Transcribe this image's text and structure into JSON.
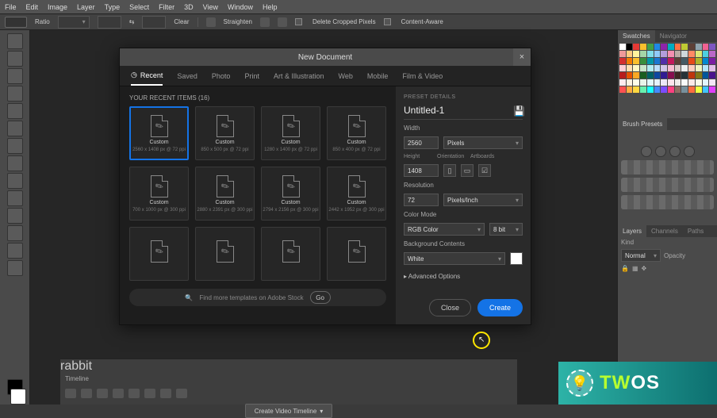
{
  "menubar": [
    "File",
    "Edit",
    "Image",
    "Layer",
    "Type",
    "Select",
    "Filter",
    "3D",
    "View",
    "Window",
    "Help"
  ],
  "optbar": {
    "ratio_label": "Ratio",
    "clear_label": "Clear",
    "straighten_label": "Straighten",
    "delete_cropped_label": "Delete Cropped Pixels",
    "content_aware_label": "Content-Aware"
  },
  "right": {
    "swatches_tab": "Swatches",
    "navigator_tab": "Navigator",
    "brush_tab": "Brush Presets",
    "layers_tab": "Layers",
    "channels_tab": "Channels",
    "paths_tab": "Paths",
    "kind_label": "Kind",
    "normal_label": "Normal",
    "opacity_label": "Opacity"
  },
  "dialog": {
    "title": "New Document",
    "tabs": {
      "recent": "Recent",
      "saved": "Saved",
      "photo": "Photo",
      "print": "Print",
      "art": "Art & Illustration",
      "web": "Web",
      "mobile": "Mobile",
      "film": "Film & Video"
    },
    "recent_header": "YOUR RECENT ITEMS (16)",
    "presets": [
      {
        "label": "Custom",
        "dim": "2560 x 1408 px @ 72 ppi"
      },
      {
        "label": "Custom",
        "dim": "850 x 500 px @ 72 ppi"
      },
      {
        "label": "Custom",
        "dim": "1280 x 1400 px @ 72 ppi"
      },
      {
        "label": "Custom",
        "dim": "850 x 400 px @ 72 ppi"
      },
      {
        "label": "Custom",
        "dim": "700 x 1000 px @ 300 ppi"
      },
      {
        "label": "Custom",
        "dim": "2880 x 2391 px @ 300 ppi"
      },
      {
        "label": "Custom",
        "dim": "2794 x 2156 px @ 300 ppi"
      },
      {
        "label": "Custom",
        "dim": "2442 x 1952 px @ 300 ppi"
      },
      {
        "label": "",
        "dim": ""
      },
      {
        "label": "",
        "dim": ""
      },
      {
        "label": "",
        "dim": ""
      },
      {
        "label": "",
        "dim": ""
      }
    ],
    "stock_text": "Find more templates on Adobe Stock",
    "go_label": "Go",
    "details": {
      "header": "PRESET DETAILS",
      "name": "Untitled-1",
      "width_label": "Width",
      "width_value": "2560",
      "width_unit": "Pixels",
      "height_label": "Height",
      "height_value": "1408",
      "orientation_label": "Orientation",
      "artboards_label": "Artboards",
      "resolution_label": "Resolution",
      "resolution_value": "72",
      "resolution_unit": "Pixels/Inch",
      "colormode_label": "Color Mode",
      "colormode_value": "RGB Color",
      "colordepth": "8 bit",
      "bg_label": "Background Contents",
      "bg_value": "White",
      "advanced": "Advanced Options",
      "close": "Close",
      "create": "Create"
    }
  },
  "timeline": {
    "tab": "Timeline",
    "create_btn": "Create Video Timeline"
  },
  "watermark": {
    "a": "TW",
    "b": "OS"
  },
  "swatch_colors": [
    "#ffffff",
    "#000000",
    "#e53935",
    "#fbc02d",
    "#43a047",
    "#1e88e5",
    "#8e24aa",
    "#00acc1",
    "#ff7043",
    "#c0ca33",
    "#5d4037",
    "#90a4ae",
    "#f06292",
    "#7e57c2",
    "#ef9a9a",
    "#ffcc80",
    "#fff59d",
    "#a5d6a7",
    "#80deea",
    "#90caf9",
    "#b39ddb",
    "#f48fb1",
    "#bcaaa4",
    "#cfd8dc",
    "#ff8a65",
    "#dce775",
    "#4dd0e1",
    "#ba68c8",
    "#d32f2f",
    "#f57c00",
    "#fbc02d",
    "#388e3c",
    "#0097a7",
    "#1976d2",
    "#512da8",
    "#c2185b",
    "#5d4037",
    "#455a64",
    "#e64a19",
    "#afb42b",
    "#0288d1",
    "#7b1fa2",
    "#ffcdd2",
    "#ffe0b2",
    "#fff9c4",
    "#c8e6c9",
    "#b2ebf2",
    "#bbdefb",
    "#d1c4e9",
    "#f8bbd0",
    "#d7ccc8",
    "#eceff1",
    "#ffccbc",
    "#f0f4c3",
    "#b3e5fc",
    "#e1bee7",
    "#b71c1c",
    "#e65100",
    "#f9a825",
    "#1b5e20",
    "#006064",
    "#0d47a1",
    "#311b92",
    "#880e4f",
    "#3e2723",
    "#263238",
    "#bf360c",
    "#827717",
    "#01579b",
    "#4a148c",
    "#ffebee",
    "#fff3e0",
    "#fffde7",
    "#e8f5e9",
    "#e0f7fa",
    "#e3f2fd",
    "#ede7f6",
    "#fce4ec",
    "#efebe9",
    "#fafafa",
    "#fbe9e7",
    "#f9fbe7",
    "#e1f5fe",
    "#f3e5f5",
    "#ff5252",
    "#ffab40",
    "#ffd740",
    "#69f0ae",
    "#18ffff",
    "#448aff",
    "#7c4dff",
    "#ff4081",
    "#8d6e63",
    "#78909c",
    "#ff6e40",
    "#eeff41",
    "#40c4ff",
    "#e040fb"
  ]
}
